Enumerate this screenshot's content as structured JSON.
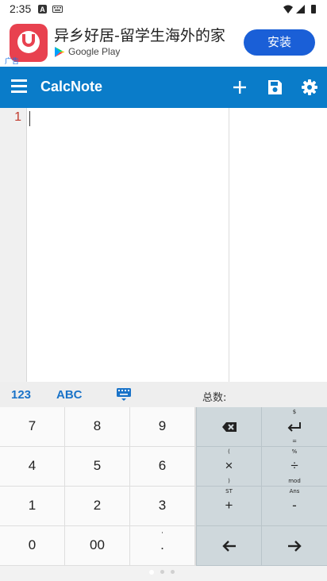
{
  "status_bar": {
    "time": "2:35"
  },
  "ad": {
    "tag": "广告",
    "title": "异乡好居-留学生海外的家",
    "store_label": "Google Play",
    "install_label": "安装"
  },
  "app_bar": {
    "title": "CalcNote"
  },
  "editor": {
    "line_number": "1"
  },
  "keyboard_toolbar": {
    "tab_numeric": "123",
    "tab_alpha": "ABC",
    "total_label": "总数:"
  },
  "keypad": {
    "k7": "7",
    "k8": "8",
    "k9": "9",
    "k4": "4",
    "k5": "5",
    "k6": "6",
    "k1": "1",
    "k2": "2",
    "k3": "3",
    "k0": "0",
    "k00": "00",
    "kdot": ".",
    "kcomma": ",",
    "sub_backspace": "⌫",
    "sub_enter": "$",
    "mul": "×",
    "mul_top": "(",
    "mul_bot": ")",
    "div": "÷",
    "div_top": "%",
    "div_bot": "mod",
    "div_top2": "=",
    "plus": "+",
    "plus_top": "ST",
    "minus": "-",
    "minus_top": "Ans"
  },
  "colors": {
    "app_bar": "#0a7cc9",
    "accent": "#1a73c8",
    "install_button": "#1a5fd7",
    "line_number": "#c0392b",
    "operator_keys": "#cfd8dc"
  },
  "icons": {
    "menu": "menu-icon",
    "add": "plus-icon",
    "save": "save-icon",
    "settings": "gear-icon",
    "keyboard": "keyboard-icon",
    "backspace": "backspace-icon",
    "enter": "enter-icon",
    "left": "arrow-left-icon",
    "right": "arrow-right-icon"
  }
}
